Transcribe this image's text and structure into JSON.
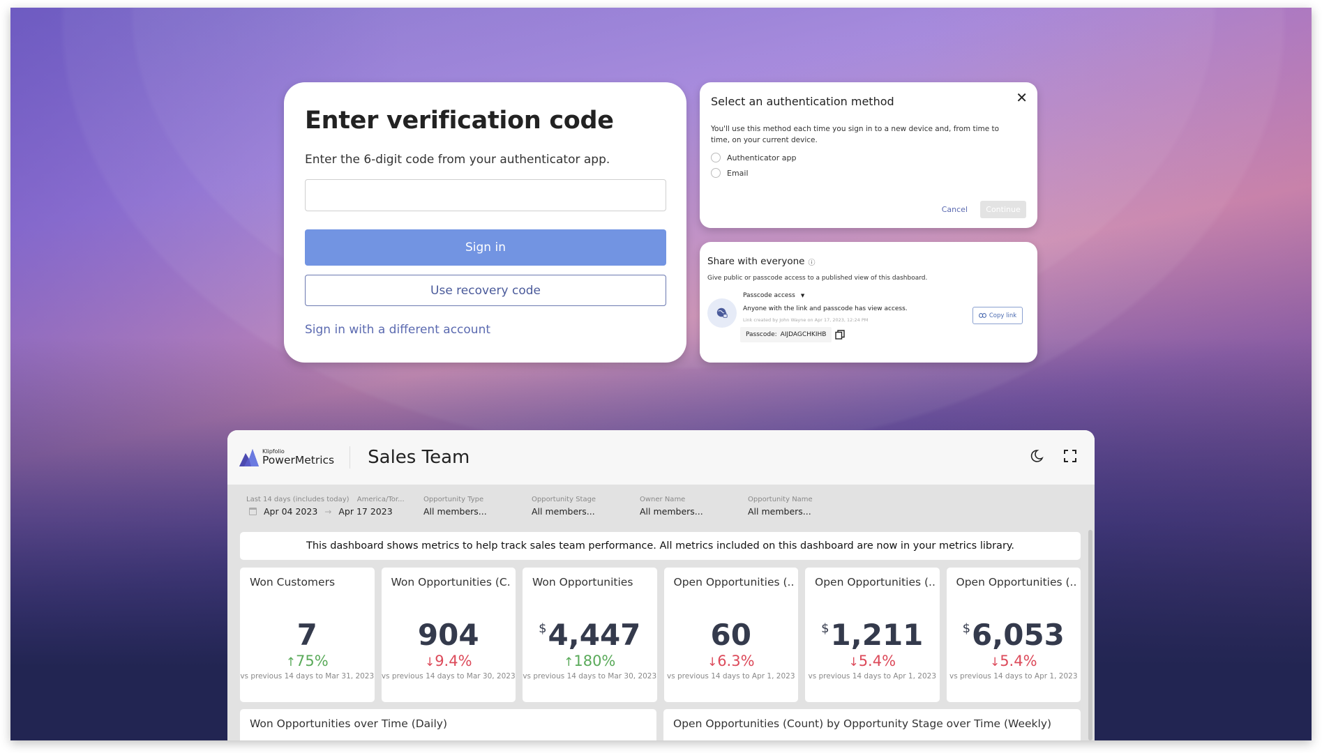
{
  "verify": {
    "title": "Enter verification code",
    "subtitle": "Enter the 6-digit code from your authenticator app.",
    "code_value": "",
    "code_placeholder": "",
    "sign_in_label": "Sign in",
    "recovery_label": "Use recovery code",
    "different_account_label": "Sign in with a different account"
  },
  "auth": {
    "title": "Select an authentication method",
    "close_icon": "close-icon",
    "description": "You'll use this method each time you sign in to a new device and, from time to time, on your current device.",
    "options": [
      {
        "label": "Authenticator app",
        "selected": false
      },
      {
        "label": "Email",
        "selected": false
      }
    ],
    "cancel_label": "Cancel",
    "continue_label": "Continue"
  },
  "share": {
    "title": "Share with everyone",
    "info_icon": "info-icon",
    "description": "Give public or passcode access to a published view of this dashboard.",
    "access_type": "Passcode access",
    "access_description": "Anyone with the link and passcode has view access.",
    "link_meta": "Link created by John Wayne on Apr 17, 2023, 12:24 PM",
    "passcode_label": "Passcode:",
    "passcode_value": "AIJDAGCHKIHB",
    "copy_link_label": "Copy link"
  },
  "dashboard": {
    "brand_small": "Klipfolio",
    "brand_big": "PowerMetrics",
    "title": "Sales Team",
    "header_icons": [
      "moon-icon",
      "fullscreen-icon"
    ],
    "filters": {
      "date_range_label": "Last 14 days (includes today)",
      "timezone_label": "America/Tor...",
      "date_start": "Apr 04 2023",
      "date_end": "Apr 17 2023",
      "others": [
        {
          "label": "Opportunity Type",
          "value": "All members..."
        },
        {
          "label": "Opportunity Stage",
          "value": "All members..."
        },
        {
          "label": "Owner Name",
          "value": "All members..."
        },
        {
          "label": "Opportunity Name",
          "value": "All members..."
        }
      ]
    },
    "notice": "This dashboard shows metrics to help track sales team performance. All metrics included on this dashboard are now in your metrics library.",
    "kpis": [
      {
        "title": "Won Customers",
        "prefix": "",
        "value": "7",
        "delta": "75%",
        "direction": "up",
        "arrow": "↑",
        "comparison": "vs previous 14 days to Mar 31, 2023"
      },
      {
        "title": "Won Opportunities (C...",
        "prefix": "",
        "value": "904",
        "delta": "9.4%",
        "direction": "down",
        "arrow": "↓",
        "comparison": "vs previous 14 days to Mar 30, 2023"
      },
      {
        "title": "Won Opportunities",
        "prefix": "$",
        "value": "4,447",
        "delta": "180%",
        "direction": "up",
        "arrow": "↑",
        "comparison": "vs previous 14 days to Mar 30, 2023"
      },
      {
        "title": "Open Opportunities (...",
        "prefix": "",
        "value": "60",
        "delta": "6.3%",
        "direction": "down",
        "arrow": "↓",
        "comparison": "vs previous 14 days to Apr 1, 2023"
      },
      {
        "title": "Open Opportunities (...",
        "prefix": "$",
        "value": "1,211",
        "delta": "5.4%",
        "direction": "down",
        "arrow": "↓",
        "comparison": "vs previous 14 days to Apr 1, 2023"
      },
      {
        "title": "Open Opportunities (...",
        "prefix": "$",
        "value": "6,053",
        "delta": "5.4%",
        "direction": "down",
        "arrow": "↓",
        "comparison": "vs previous 14 days to Apr 1, 2023"
      }
    ],
    "charts": [
      {
        "title": "Won Opportunities over Time (Daily)"
      },
      {
        "title": "Open Opportunities (Count) by Opportunity Stage over Time (Weekly)"
      }
    ]
  },
  "colors": {
    "primary_button": "#7294e2",
    "link": "#5b6ab0",
    "positive": "#5aaa5a",
    "negative": "#dc4a5a",
    "kpi_value": "#343a4c"
  }
}
